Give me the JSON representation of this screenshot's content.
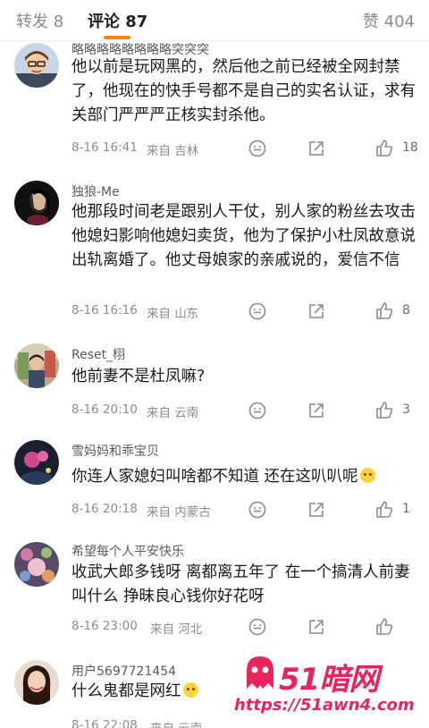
{
  "tabs": {
    "reposts": "转发 8",
    "comments": "评论 87",
    "likes": "赞 404"
  },
  "comments": [
    {
      "username": "略略略略略略略略突突突",
      "content": "他以前是玩网黑的，然后他之前已经被全网封禁了，他现在的快手号都不是自己的实名认证，求有关部门严严严正核实封杀他。",
      "time": "8-16 16:41",
      "location": "来自 吉林",
      "likes": "18"
    },
    {
      "username": "独狼-Me",
      "content": "他那段时间老是跟别人干仗，别人家的粉丝去攻击他媳妇影响他媳妇卖货，他为了保护小杜凤故意说出轨离婚了。他丈母娘家的亲戚说的，爱信不信",
      "time": "8-16 16:16",
      "location": "来自 山东",
      "likes": "8"
    },
    {
      "username": "Reset_栩",
      "content": "他前妻不是杜凤嘛?",
      "time": "8-16 20:10",
      "location": "来自 云南",
      "likes": "3"
    },
    {
      "username": "雪妈妈和乖宝贝",
      "content": "你连人家媳妇叫啥都不知道  还在这叭叭呢",
      "time": "8-16 20:18",
      "location": "来自 内蒙古",
      "likes": "1"
    },
    {
      "username": "希望每个人平安快乐",
      "content": "收武大郎多钱呀 离都离五年了 在一个搞清人前妻叫什么 挣昧良心钱你好花呀",
      "time": "8-16 23:00",
      "location": "来自 河北",
      "likes": ""
    },
    {
      "username": "用户5697721454",
      "content": "什么鬼都是网红",
      "time": "8-16 22:08",
      "location": "来自 云南",
      "likes": ""
    }
  ],
  "icons": {
    "reply": "comment-bubble-icon",
    "share": "share-icon",
    "like": "thumbs-up-icon"
  },
  "watermark": {
    "brand": "51暗网",
    "url": "https://51awn4.com"
  },
  "colors": {
    "accent": "#ff8200",
    "watermark": "#e8245c",
    "meta_text": "#8c8c8c"
  }
}
